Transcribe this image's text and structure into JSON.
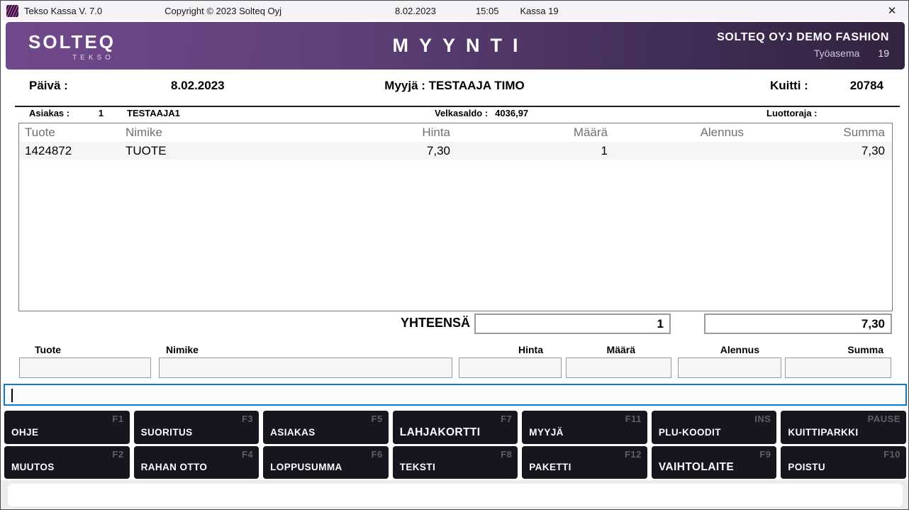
{
  "titlebar": {
    "app_title": "Tekso Kassa V. 7.0",
    "copyright": "Copyright © 2023 Solteq Oyj",
    "date": "8.02.2023",
    "time": "15:05",
    "register": "Kassa 19",
    "close_icon": "✕"
  },
  "header": {
    "logo_primary": "SOLTEQ",
    "logo_secondary": "TEKSO",
    "page_title": "MYYNTI",
    "store_name": "SOLTEQ OYJ DEMO FASHION",
    "workstation_label": "Työasema",
    "workstation_number": "19",
    "gradient_left": "#71498c",
    "gradient_right": "#32233f"
  },
  "info_row": {
    "date_label": "Päivä :",
    "date_value": "8.02.2023",
    "seller_label": "Myyjä :",
    "seller_value": "TESTAAJA TIMO",
    "receipt_label": "Kuitti :",
    "receipt_value": "20784"
  },
  "customer_row": {
    "customer_label": "Asiakas :",
    "customer_number": "1",
    "customer_name": "TESTAAJA1",
    "debt_label": "Velkasaldo :",
    "debt_value": "4036,97",
    "credit_label": "Luottoraja :",
    "credit_value": ""
  },
  "table": {
    "headers": {
      "product": "Tuote",
      "name": "Nimike",
      "price": "Hinta",
      "quantity": "Määrä",
      "discount": "Alennus",
      "sum": "Summa"
    },
    "rows": [
      {
        "product": "1424872",
        "name": "TUOTE",
        "price": "7,30",
        "quantity": "1",
        "discount": "",
        "sum": "7,30"
      }
    ]
  },
  "totals": {
    "label": "YHTEENSÄ",
    "quantity": "1",
    "sum": "7,30"
  },
  "entry": {
    "product_label": "Tuote",
    "name_label": "Nimike",
    "price_label": "Hinta",
    "quantity_label": "Määrä",
    "discount_label": "Alennus",
    "sum_label": "Summa",
    "product_value": "",
    "name_value": "",
    "price_value": "",
    "quantity_value": "",
    "discount_value": "",
    "sum_value": ""
  },
  "command_bar": {
    "value": ""
  },
  "function_keys": {
    "row1": [
      {
        "label": "OHJE",
        "key": "F1"
      },
      {
        "label": "SUORITUS",
        "key": "F3"
      },
      {
        "label": "ASIAKAS",
        "key": "F5"
      },
      {
        "label": "LAHJAKORTTI",
        "key": "F7"
      },
      {
        "label": "MYYJÄ",
        "key": "F11"
      },
      {
        "label": "PLU-KOODIT",
        "key": "INS"
      },
      {
        "label": "KUITTIPARKKI",
        "key": "PAUSE"
      }
    ],
    "row2": [
      {
        "label": "MUUTOS",
        "key": "F2"
      },
      {
        "label": "RAHAN OTTO",
        "key": "F4"
      },
      {
        "label": "LOPPUSUMMA",
        "key": "F6"
      },
      {
        "label": "TEKSTI",
        "key": "F8"
      },
      {
        "label": "PAKETTI",
        "key": "F12"
      },
      {
        "label": "VAIHTOLAITE",
        "key": "F9"
      },
      {
        "label": "POISTU",
        "key": "F10"
      }
    ]
  }
}
